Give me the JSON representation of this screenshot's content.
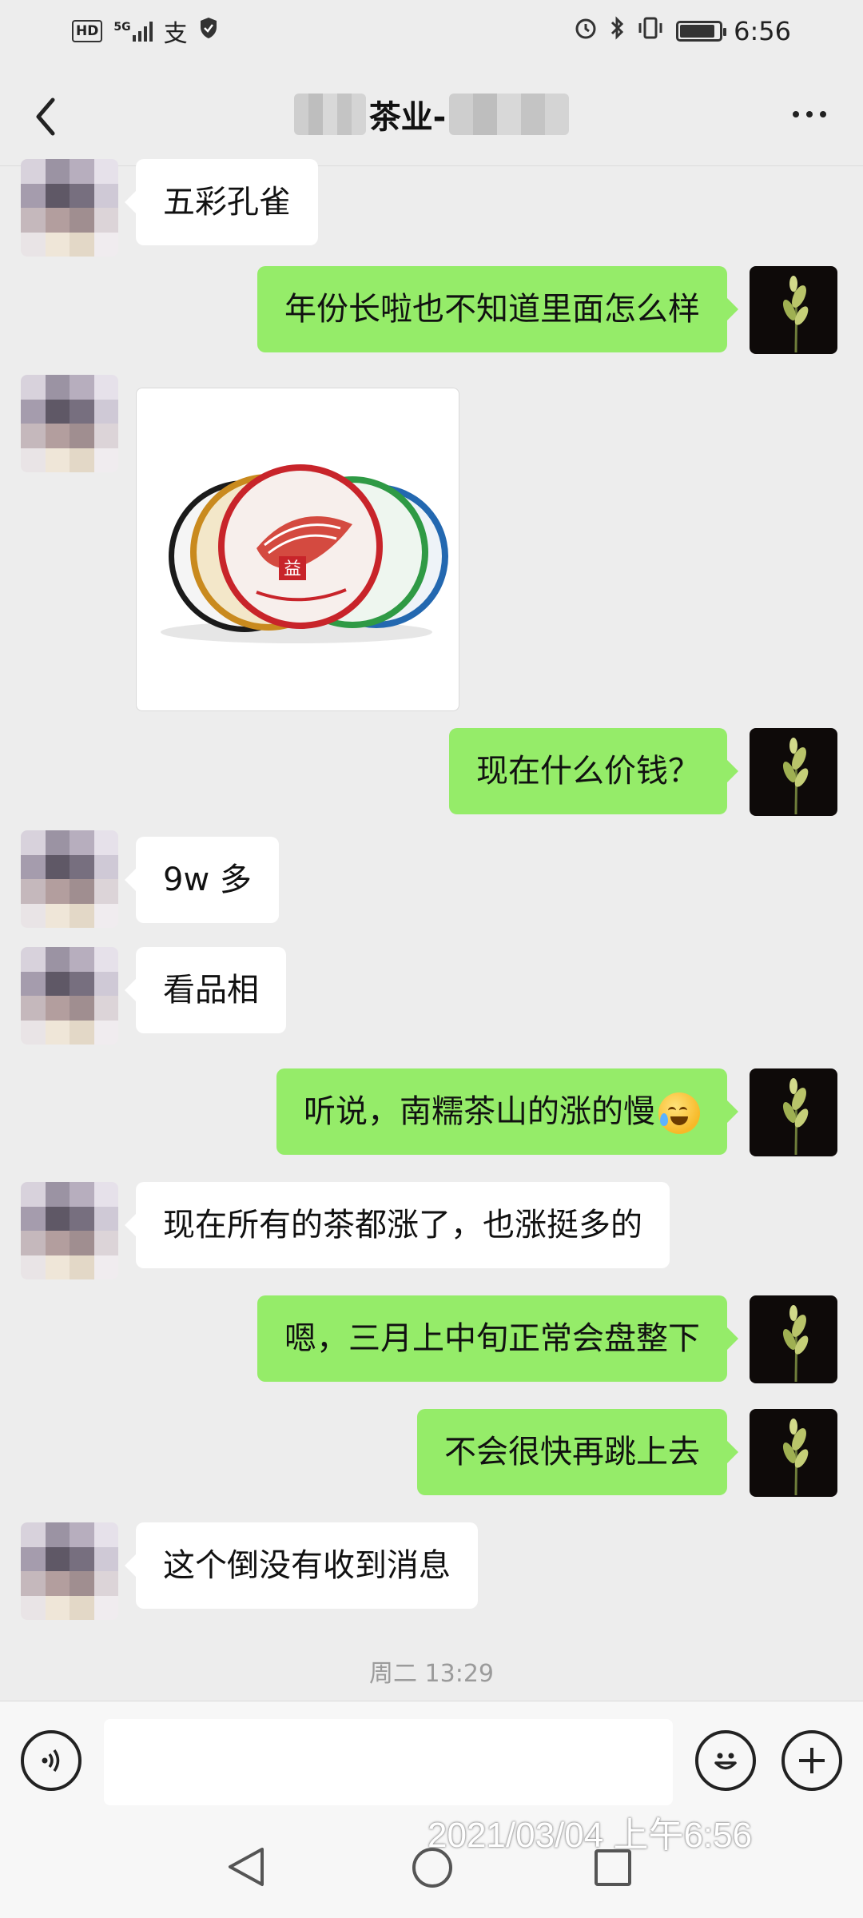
{
  "status_bar": {
    "hd": "HD",
    "network": "5G",
    "time": "6:56",
    "icons": [
      "hd-icon",
      "signal-icon",
      "alipay-icon",
      "shield-icon",
      "alarm-icon",
      "bluetooth-icon",
      "vibrate-icon",
      "battery-icon"
    ]
  },
  "header": {
    "title": "茶业-",
    "back_icon": "back-chevron-icon",
    "more_icon": "more-dots-icon"
  },
  "messages": [
    {
      "side": "left",
      "text": "五彩孔雀"
    },
    {
      "side": "right",
      "text": "年份长啦也不知道里面怎么样"
    },
    {
      "side": "left",
      "type": "image",
      "alt": "tea-cakes-image"
    },
    {
      "side": "right",
      "text": "现在什么价钱？"
    },
    {
      "side": "left",
      "text": "9w 多"
    },
    {
      "side": "left",
      "text": "看品相"
    },
    {
      "side": "right",
      "text": "听说，南糯茶山的涨的慢",
      "emoji": "laughing-tears-emoji"
    },
    {
      "side": "left",
      "text": "现在所有的茶都涨了，也涨挺多的"
    },
    {
      "side": "right",
      "text": "嗯，三月上中旬正常会盘整下"
    },
    {
      "side": "right",
      "text": "不会很快再跳上去"
    },
    {
      "side": "left",
      "text": "这个倒没有收到消息"
    }
  ],
  "timestamp": "周二 13:29",
  "input_bar": {
    "voice_icon": "voice-icon",
    "emoji_icon": "emoji-icon",
    "plus_icon": "plus-icon",
    "text_value": ""
  },
  "watermark": "2021/03/04 上午6:56",
  "colors": {
    "background": "#ededed",
    "bubble_self": "#95ec69",
    "bubble_other": "#ffffff"
  }
}
